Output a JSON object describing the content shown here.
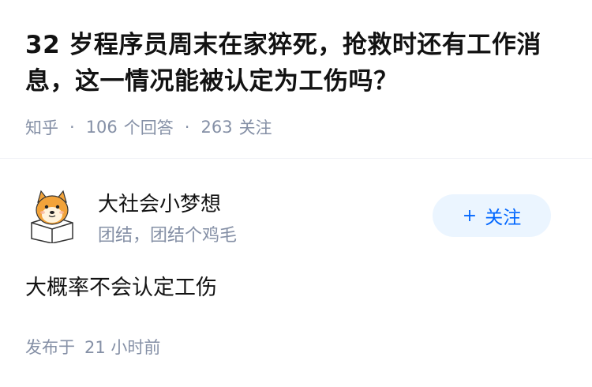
{
  "question": {
    "title": "32 岁程序员周末在家猝死，抢救时还有工作消息，这一情况能被认定为工伤吗？",
    "source": "知乎",
    "answer_count": "106",
    "answer_label": "个回答",
    "follower_count": "263",
    "follower_label": "关注"
  },
  "author": {
    "name": "大社会小梦想",
    "bio": "团结，团结个鸡毛",
    "avatar_icon": "shiba-dog-avatar-icon"
  },
  "follow_button": {
    "plus": "+",
    "label": "关注"
  },
  "answer": {
    "content": "大概率不会认定工伤",
    "publish_prefix": "发布于",
    "publish_time": "21 小时前"
  },
  "colors": {
    "text_primary": "#121212",
    "text_secondary": "#8590a6",
    "accent": "#0066ff",
    "button_bg": "#ebf5ff"
  }
}
